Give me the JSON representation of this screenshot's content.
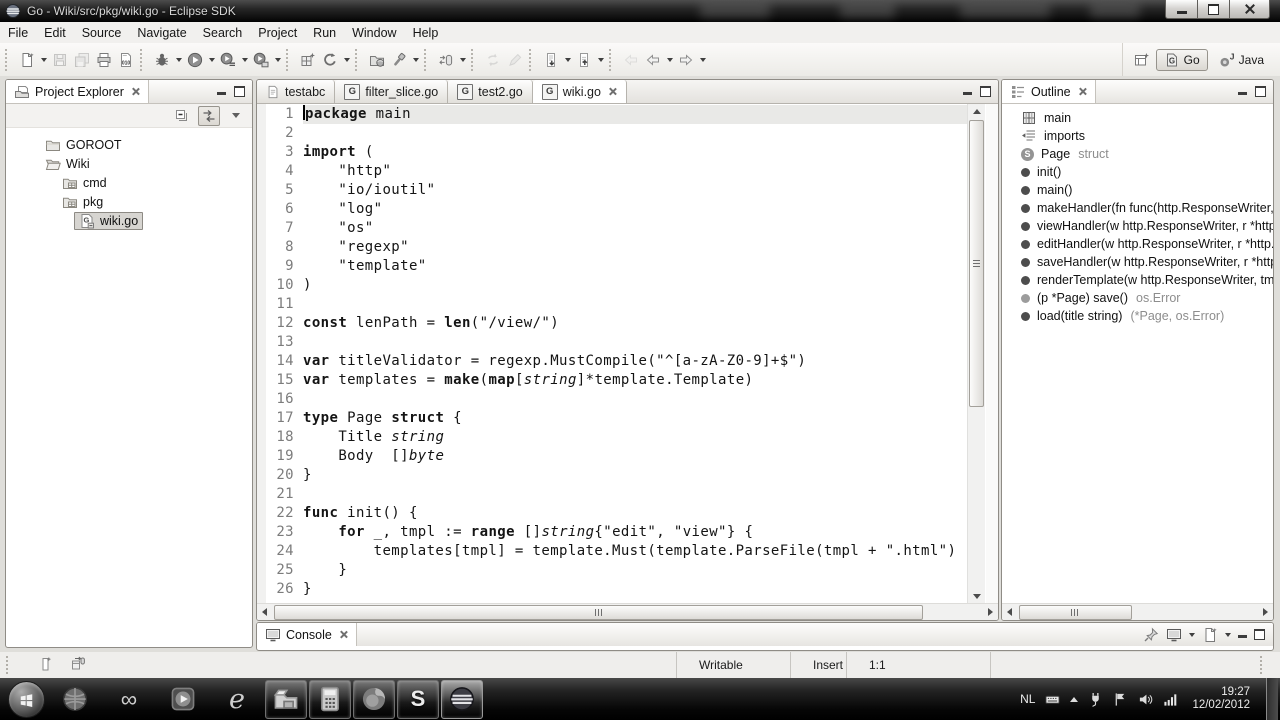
{
  "window": {
    "title": "Go - Wiki/src/pkg/wiki.go - Eclipse SDK"
  },
  "menubar": [
    "File",
    "Edit",
    "Source",
    "Navigate",
    "Search",
    "Project",
    "Run",
    "Window",
    "Help"
  ],
  "toolbar": {
    "groups": [
      [
        {
          "name": "new",
          "icon": "new-doc",
          "dropdown": true
        },
        {
          "name": "save",
          "icon": "floppy",
          "disabled": true
        },
        {
          "name": "save-all",
          "icon": "floppy-all",
          "disabled": true
        },
        {
          "name": "print",
          "icon": "printer"
        },
        {
          "name": "binary-view",
          "icon": "binary-doc"
        }
      ],
      [
        {
          "name": "debug",
          "icon": "bug",
          "dropdown": true
        },
        {
          "name": "run",
          "icon": "run",
          "dropdown": true
        },
        {
          "name": "run-history",
          "icon": "run-history",
          "dropdown": true
        },
        {
          "name": "run-config",
          "icon": "run-config",
          "dropdown": true
        }
      ],
      [
        {
          "name": "new-project",
          "icon": "new-grid"
        },
        {
          "name": "gc",
          "icon": "gc",
          "dropdown": true
        }
      ],
      [
        {
          "name": "open-resource",
          "icon": "folder-ball"
        },
        {
          "name": "search",
          "icon": "flashlight",
          "dropdown": true
        }
      ],
      [
        {
          "name": "external-tools",
          "icon": "cylinder",
          "dropdown": true
        }
      ],
      [
        {
          "name": "refresh",
          "icon": "sync-grey",
          "disabled": true
        },
        {
          "name": "mark-occurrences",
          "icon": "pen-grey",
          "disabled": true
        }
      ],
      [
        {
          "name": "next-annotation",
          "icon": "annot-down",
          "dropdown": true
        },
        {
          "name": "prev-annotation",
          "icon": "annot-up",
          "dropdown": true
        }
      ],
      [
        {
          "name": "last-edit-location",
          "icon": "nav-grey",
          "disabled": true
        },
        {
          "name": "back",
          "icon": "nav-back",
          "dropdown": true
        },
        {
          "name": "forward",
          "icon": "nav-forward",
          "dropdown": true
        }
      ]
    ],
    "perspectives": [
      {
        "label": "Go",
        "icon": "go-badge",
        "active": true
      },
      {
        "label": "Java",
        "icon": "java-badge",
        "active": false
      }
    ]
  },
  "project_explorer": {
    "title": "Project Explorer",
    "tree": [
      {
        "icon": "folder",
        "label": "GOROOT",
        "indent": 0
      },
      {
        "icon": "folder-open",
        "label": "Wiki",
        "indent": 0
      },
      {
        "icon": "pkg-folder",
        "label": "cmd",
        "indent": 1
      },
      {
        "icon": "pkg-folder",
        "label": "pkg",
        "indent": 1
      },
      {
        "icon": "go-file",
        "label": "wiki.go",
        "indent": 2,
        "selected": true
      }
    ]
  },
  "editor": {
    "tabs": [
      {
        "label": "testabc",
        "icon": "doc-file",
        "active": false
      },
      {
        "label": "filter_slice.go",
        "icon": "go-badge",
        "active": false
      },
      {
        "label": "test2.go",
        "icon": "go-badge",
        "active": false
      },
      {
        "label": "wiki.go",
        "icon": "go-badge",
        "active": true
      }
    ],
    "lines": [
      [
        [
          "k",
          "package"
        ],
        [
          "p",
          " main"
        ]
      ],
      [],
      [
        [
          "k",
          "import"
        ],
        [
          "p",
          " ("
        ]
      ],
      [
        [
          "p",
          "    \"http\""
        ]
      ],
      [
        [
          "p",
          "    \"io/ioutil\""
        ]
      ],
      [
        [
          "p",
          "    \"log\""
        ]
      ],
      [
        [
          "p",
          "    \"os\""
        ]
      ],
      [
        [
          "p",
          "    \"regexp\""
        ]
      ],
      [
        [
          "p",
          "    \"template\""
        ]
      ],
      [
        [
          "p",
          ")"
        ]
      ],
      [],
      [
        [
          "k",
          "const"
        ],
        [
          "p",
          " lenPath = "
        ],
        [
          "k",
          "len"
        ],
        [
          "p",
          "(\"/view/\")"
        ]
      ],
      [],
      [
        [
          "k",
          "var"
        ],
        [
          "p",
          " titleValidator = regexp.MustCompile(\"^[a-zA-Z0-9]+$\")"
        ]
      ],
      [
        [
          "k",
          "var"
        ],
        [
          "p",
          " templates = "
        ],
        [
          "k",
          "make"
        ],
        [
          "p",
          "("
        ],
        [
          "k",
          "map"
        ],
        [
          "p",
          "["
        ],
        [
          "i",
          "string"
        ],
        [
          "p",
          "]*template.Template)"
        ]
      ],
      [],
      [
        [
          "k",
          "type"
        ],
        [
          "p",
          " Page "
        ],
        [
          "k",
          "struct"
        ],
        [
          "p",
          " {"
        ]
      ],
      [
        [
          "p",
          "    Title "
        ],
        [
          "i",
          "string"
        ]
      ],
      [
        [
          "p",
          "    Body  []"
        ],
        [
          "i",
          "byte"
        ]
      ],
      [
        [
          "p",
          "}"
        ]
      ],
      [],
      [
        [
          "k",
          "func"
        ],
        [
          "p",
          " init() {"
        ]
      ],
      [
        [
          "p",
          "    "
        ],
        [
          "k",
          "for"
        ],
        [
          "p",
          " _, tmpl := "
        ],
        [
          "k",
          "range"
        ],
        [
          "p",
          " []"
        ],
        [
          "i",
          "string"
        ],
        [
          "p",
          "{\"edit\", \"view\"} {"
        ]
      ],
      [
        [
          "p",
          "        templates[tmpl] = template.Must(template.ParseFile(tmpl + \".html\")"
        ]
      ],
      [
        [
          "p",
          "    }"
        ]
      ],
      [
        [
          "p",
          "}"
        ]
      ]
    ]
  },
  "outline": {
    "title": "Outline",
    "items": [
      {
        "icon": "pkg-grid",
        "label": "main"
      },
      {
        "icon": "imports",
        "label": "imports"
      },
      {
        "icon": "struct",
        "label": "Page",
        "suffix": "struct"
      },
      {
        "icon": "dot",
        "label": "init()"
      },
      {
        "icon": "dot",
        "label": "main()"
      },
      {
        "icon": "dot",
        "label": "makeHandler(fn func(http.ResponseWriter,"
      },
      {
        "icon": "dot",
        "label": "viewHandler(w http.ResponseWriter, r *http."
      },
      {
        "icon": "dot",
        "label": "editHandler(w http.ResponseWriter, r *http.F"
      },
      {
        "icon": "dot",
        "label": "saveHandler(w http.ResponseWriter, r *http."
      },
      {
        "icon": "dot",
        "label": "renderTemplate(w http.ResponseWriter, tmp"
      },
      {
        "icon": "dot-grey",
        "label": "(p *Page) save()",
        "suffix": "os.Error"
      },
      {
        "icon": "dot",
        "label": "load(title string)",
        "suffix": "(*Page, os.Error)"
      }
    ]
  },
  "console": {
    "title": "Console"
  },
  "statusbar": {
    "writable": "Writable",
    "insert_mode": "Insert",
    "caret_position": "1:1"
  },
  "taskbar": {
    "apps": [
      {
        "name": "start",
        "kind": "orb"
      },
      {
        "name": "media-center",
        "icon": "sphere",
        "plain": true
      },
      {
        "name": "visual-studio",
        "glyph": "∞",
        "plain": true
      },
      {
        "name": "media-player",
        "icon": "play-box",
        "plain": true
      },
      {
        "name": "internet-explorer",
        "glyph": "e",
        "plain": true
      },
      {
        "name": "file-explorer",
        "icon": "explorer",
        "open": true
      },
      {
        "name": "calculator",
        "icon": "calc",
        "open": true
      },
      {
        "name": "firefox",
        "icon": "firefox",
        "open": true
      },
      {
        "name": "skype",
        "glyph": "S",
        "open": true
      },
      {
        "name": "eclipse",
        "icon": "eclipse-ball",
        "open": true,
        "active": true
      }
    ],
    "tray": {
      "language": "NL",
      "time": "19:27",
      "date": "12/02/2012"
    }
  }
}
